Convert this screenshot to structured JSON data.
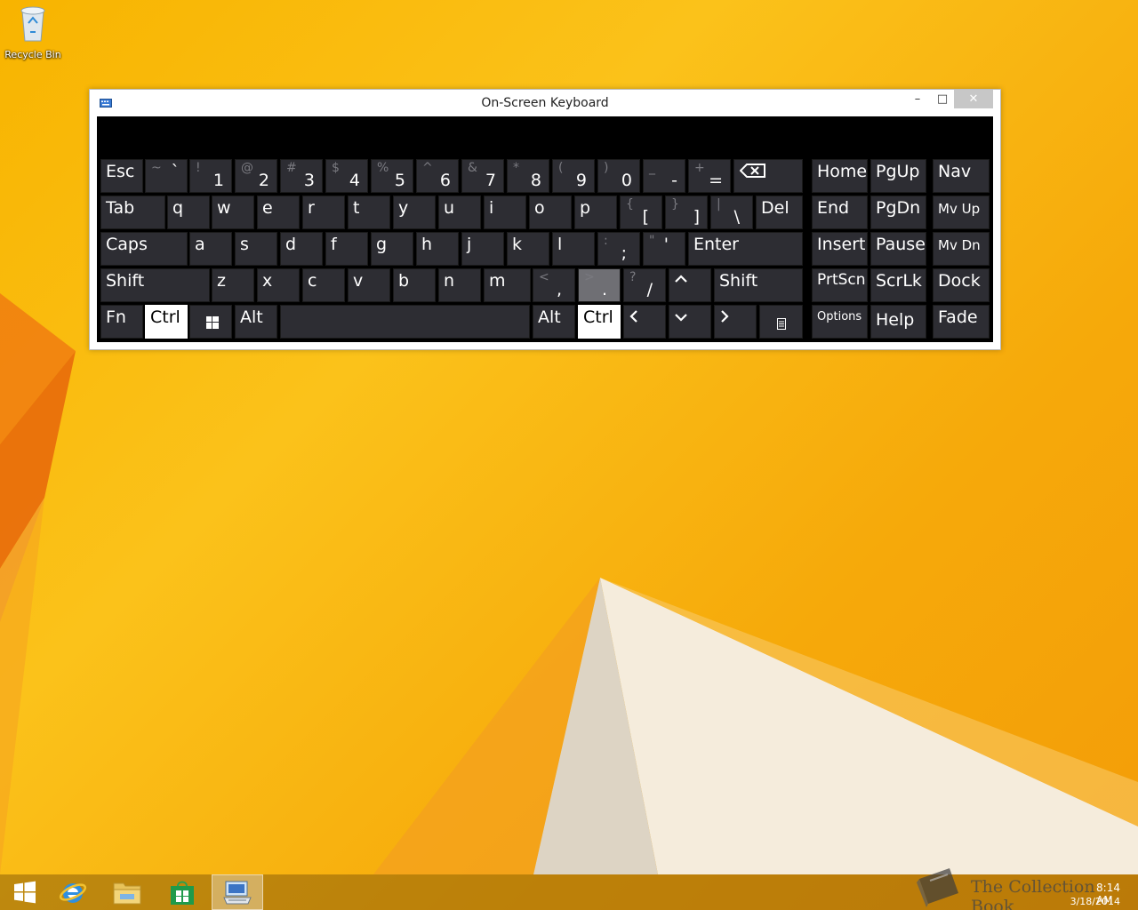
{
  "desktop": {
    "recycle_bin_label": "Recycle Bin"
  },
  "window": {
    "title": "On-Screen Keyboard",
    "minimize_glyph": "–",
    "maximize_glyph": "□",
    "close_glyph": "✕"
  },
  "keys": {
    "esc": "Esc",
    "backtick": {
      "shift": "~",
      "main": "`"
    },
    "n1": {
      "shift": "!",
      "main": "1"
    },
    "n2": {
      "shift": "@",
      "main": "2"
    },
    "n3": {
      "shift": "#",
      "main": "3"
    },
    "n4": {
      "shift": "$",
      "main": "4"
    },
    "n5": {
      "shift": "%",
      "main": "5"
    },
    "n6": {
      "shift": "^",
      "main": "6"
    },
    "n7": {
      "shift": "&",
      "main": "7"
    },
    "n8": {
      "shift": "*",
      "main": "8"
    },
    "n9": {
      "shift": "(",
      "main": "9"
    },
    "n0": {
      "shift": ")",
      "main": "0"
    },
    "minus": {
      "shift": "_",
      "main": "-"
    },
    "equals": {
      "shift": "+",
      "main": "="
    },
    "tab": "Tab",
    "q": "q",
    "w": "w",
    "e": "e",
    "r": "r",
    "t": "t",
    "y": "y",
    "u": "u",
    "i": "i",
    "o": "o",
    "p": "p",
    "lbracket": {
      "shift": "{",
      "main": "["
    },
    "rbracket": {
      "shift": "}",
      "main": "]"
    },
    "backslash": {
      "shift": "|",
      "main": "\\"
    },
    "del": "Del",
    "caps": "Caps",
    "a": "a",
    "s": "s",
    "d": "d",
    "f": "f",
    "g": "g",
    "h": "h",
    "j": "j",
    "k": "k",
    "l": "l",
    "semicolon": {
      "shift": ":",
      "main": ";"
    },
    "quote": {
      "shift": "\"",
      "main": "'"
    },
    "enter": "Enter",
    "shift_left": "Shift",
    "z": "z",
    "x": "x",
    "c": "c",
    "v": "v",
    "b": "b",
    "n": "n",
    "m": "m",
    "comma": {
      "shift": "<",
      "main": ","
    },
    "period": {
      "shift": ">",
      "main": "."
    },
    "slash": {
      "shift": "?",
      "main": "/"
    },
    "shift_right": "Shift",
    "fn": "Fn",
    "ctrl_left": "Ctrl",
    "alt_left": "Alt",
    "alt_right": "Alt",
    "ctrl_right": "Ctrl",
    "home": "Home",
    "pgup": "PgUp",
    "nav": "Nav",
    "end": "End",
    "pgdn": "PgDn",
    "mvup": "Mv Up",
    "insert": "Insert",
    "pause": "Pause",
    "mvdn": "Mv Dn",
    "prtscn": "PrtScn",
    "scrlk": "ScrLk",
    "dock": "Dock",
    "options": "Options",
    "help": "Help",
    "fade": "Fade"
  },
  "tray": {
    "time": "8:14 AM",
    "date": "3/18/2014"
  },
  "watermark": {
    "text": "The Collection Book"
  },
  "colors": {
    "key_bg": "#2d2d33",
    "key_pressed": "#ffffff",
    "key_hover": "#6f6f74",
    "keyboard_bg": "#000000"
  }
}
